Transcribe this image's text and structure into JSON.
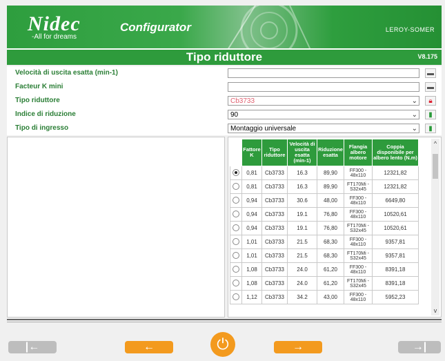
{
  "header": {
    "logo": "Nidec",
    "slogan": "-All for dreams",
    "app_title": "Configurator",
    "brand": "LEROY-SOMER"
  },
  "titlebar": {
    "title": "Tipo riduttore",
    "version": "V8.175"
  },
  "form": {
    "rows": [
      {
        "label": "Velocità di uscita esatta (min-1)",
        "value": "",
        "icon": "print-icon"
      },
      {
        "label": "Facteur K mini",
        "value": "",
        "icon": "print-icon"
      },
      {
        "label": "Tipo riduttore",
        "value": "Cb3733",
        "icon": "lock-icon"
      },
      {
        "label": "Indice di riduzione",
        "value": "90",
        "icon": "unlock-icon"
      },
      {
        "label": "Tipo di ingresso",
        "value": "Montaggio universale",
        "icon": "unlock-icon"
      }
    ]
  },
  "table": {
    "headers": [
      "Fattore K",
      "Tipo riduttore",
      "Velocità di uscita esatta (min-1)",
      "Riduzione esatta",
      "Flangia albero motore",
      "Coppia disponibile per albero lento (N.m)"
    ],
    "rows": [
      {
        "selected": true,
        "k": "0,81",
        "tipo": "Cb3733",
        "vel": "16.3",
        "rid": "89,90",
        "flangia": "FF300 - 48x110",
        "coppia": "12321,82"
      },
      {
        "selected": false,
        "k": "0,81",
        "tipo": "Cb3733",
        "vel": "16.3",
        "rid": "89,90",
        "flangia": "FT170Mi - S32x45",
        "coppia": "12321,82"
      },
      {
        "selected": false,
        "k": "0,94",
        "tipo": "Cb3733",
        "vel": "30.6",
        "rid": "48,00",
        "flangia": "FF300 - 48x110",
        "coppia": "6649,80"
      },
      {
        "selected": false,
        "k": "0,94",
        "tipo": "Cb3733",
        "vel": "19.1",
        "rid": "76,80",
        "flangia": "FF300 - 48x110",
        "coppia": "10520,61"
      },
      {
        "selected": false,
        "k": "0,94",
        "tipo": "Cb3733",
        "vel": "19.1",
        "rid": "76,80",
        "flangia": "FT170Mi - S32x45",
        "coppia": "10520,61"
      },
      {
        "selected": false,
        "k": "1,01",
        "tipo": "Cb3733",
        "vel": "21.5",
        "rid": "68,30",
        "flangia": "FF300 - 48x110",
        "coppia": "9357,81"
      },
      {
        "selected": false,
        "k": "1,01",
        "tipo": "Cb3733",
        "vel": "21.5",
        "rid": "68,30",
        "flangia": "FT170Mi - S32x45",
        "coppia": "9357,81"
      },
      {
        "selected": false,
        "k": "1,08",
        "tipo": "Cb3733",
        "vel": "24.0",
        "rid": "61,20",
        "flangia": "FF300 - 48x110",
        "coppia": "8391,18"
      },
      {
        "selected": false,
        "k": "1,08",
        "tipo": "Cb3733",
        "vel": "24.0",
        "rid": "61,20",
        "flangia": "FT170Mi - S32x45",
        "coppia": "8391,18"
      },
      {
        "selected": false,
        "k": "1,12",
        "tipo": "Cb3733",
        "vel": "34.2",
        "rid": "43,00",
        "flangia": "FF300 - 48x110",
        "coppia": "5952,23"
      }
    ]
  },
  "nav": {
    "first": "|←",
    "prev": "←",
    "power": "⏻",
    "next": "→",
    "last": "→|"
  }
}
